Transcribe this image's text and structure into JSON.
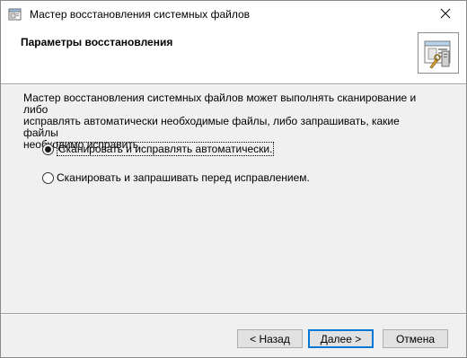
{
  "window": {
    "title": "Мастер восстановления системных файлов"
  },
  "header": {
    "title": "Параметры восстановления"
  },
  "content": {
    "description_line1": "Мастер восстановления системных файлов может выполнять сканирование и либо",
    "description_line2": "исправлять автоматически необходимые файлы, либо запрашивать, какие файлы",
    "description_line3": "необходимо исправить.",
    "options": [
      {
        "label": "Сканировать и исправлять автоматически.",
        "selected": true
      },
      {
        "label": "Сканировать и запрашивать перед исправлением.",
        "selected": false
      }
    ]
  },
  "buttons": {
    "back": "< Назад",
    "next": "Далее >",
    "cancel": "Отмена"
  },
  "icons": {
    "title": "wizard-icon",
    "header": "computer-wrench-icon",
    "close": "close-icon"
  }
}
